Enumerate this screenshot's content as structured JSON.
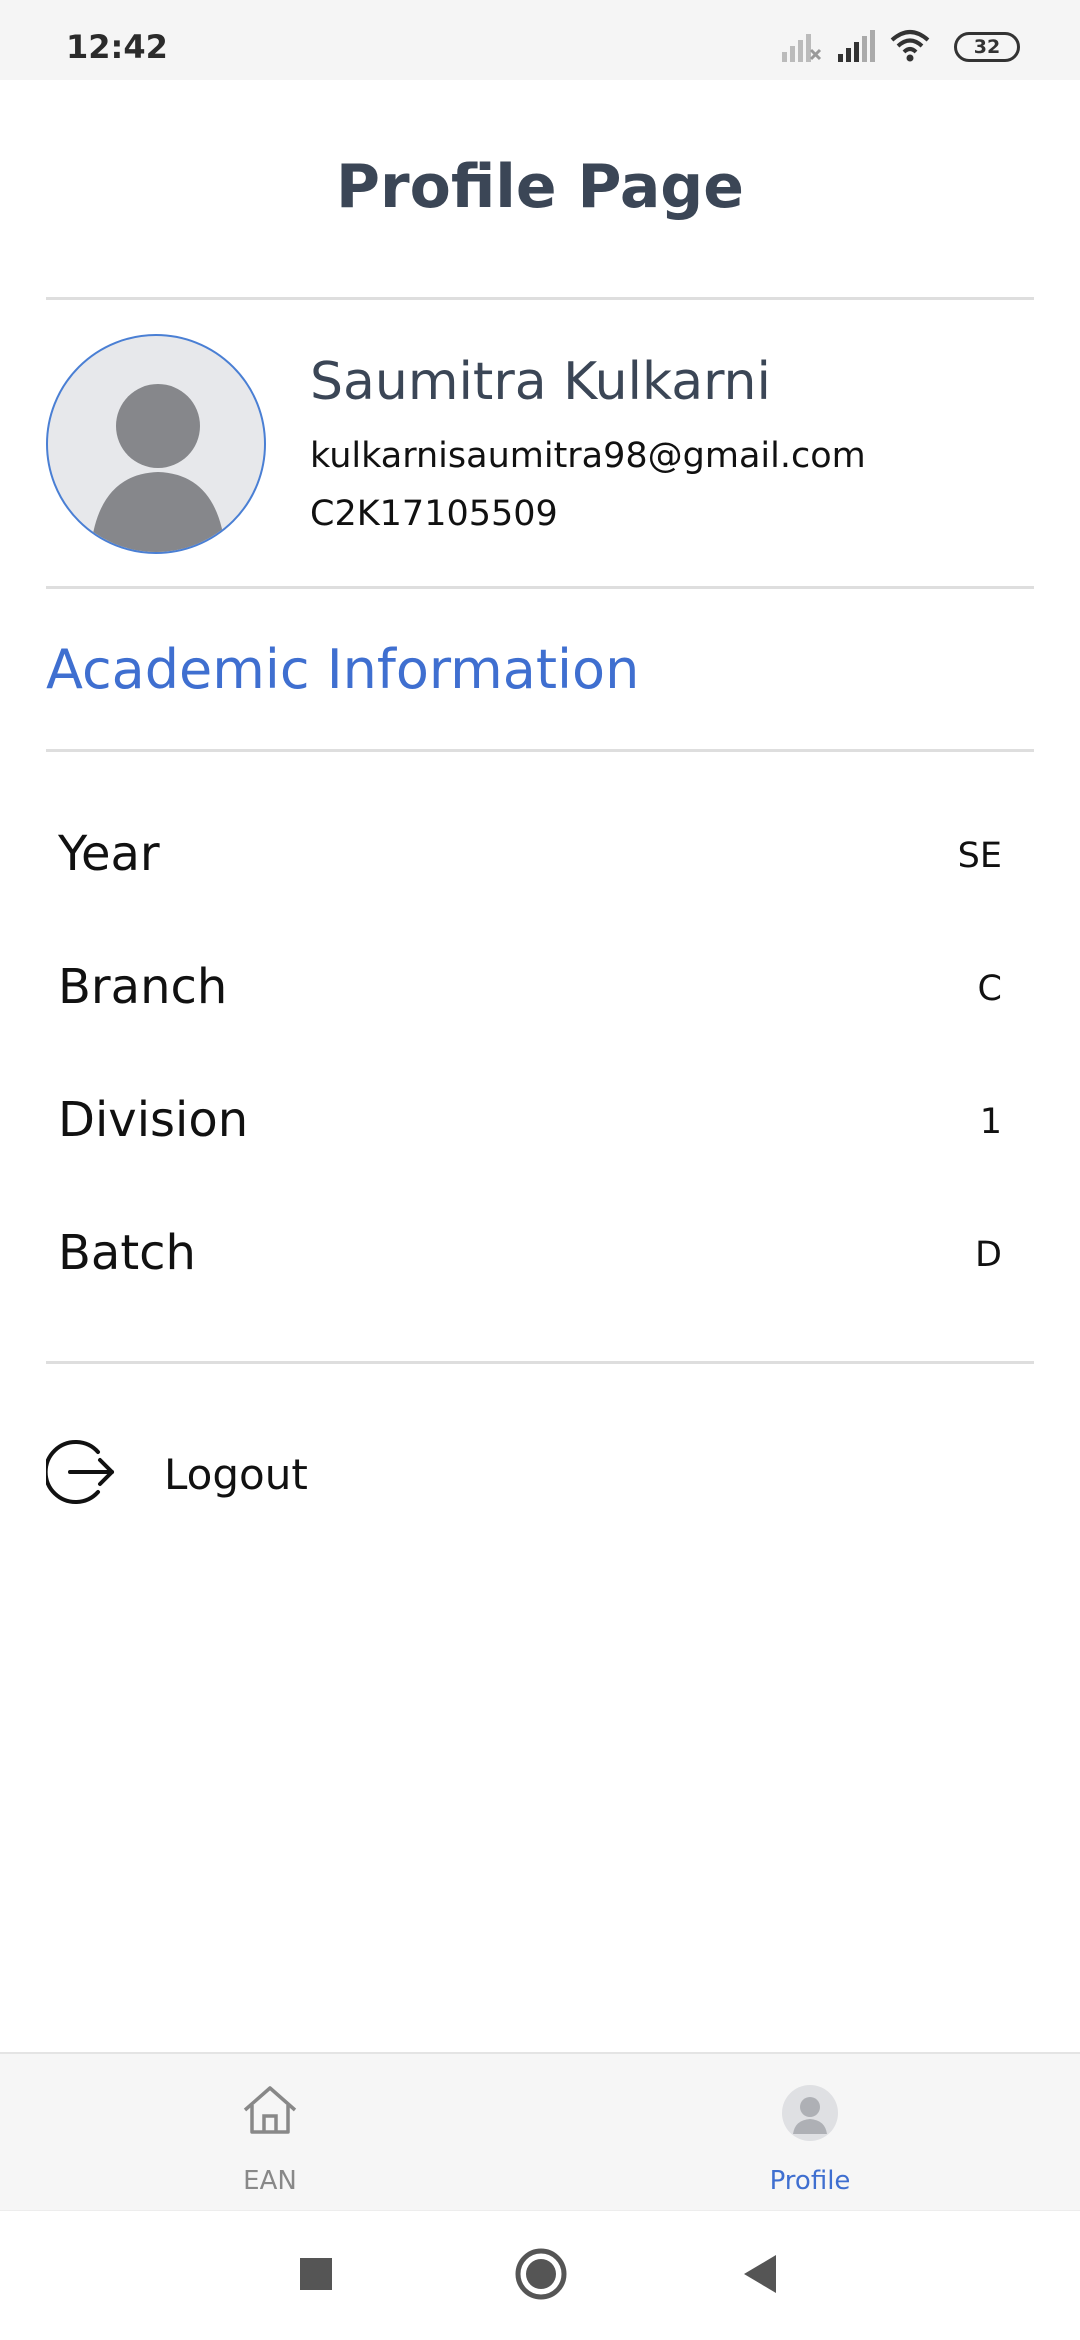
{
  "status_bar": {
    "time": "12:42",
    "battery": "32",
    "icons": [
      "signal-muted-icon",
      "signal-icon",
      "wifi-icon",
      "battery-icon"
    ]
  },
  "header": {
    "title": "Profile Page"
  },
  "profile": {
    "name": "Saumitra Kulkarni",
    "email": "kulkarnisaumitra98@gmail.com",
    "id": "C2K17105509",
    "avatar_icon": "avatar-placeholder-icon"
  },
  "academic": {
    "title": "Academic Information",
    "rows": [
      {
        "label": "Year",
        "value": "SE"
      },
      {
        "label": "Branch",
        "value": "C"
      },
      {
        "label": "Division",
        "value": "1"
      },
      {
        "label": "Batch",
        "value": "D"
      }
    ]
  },
  "logout": {
    "label": "Logout",
    "icon": "logout-icon"
  },
  "bottom_nav": {
    "items": [
      {
        "label": "EAN",
        "icon": "home-icon",
        "active": false
      },
      {
        "label": "Profile",
        "icon": "profile-icon",
        "active": true
      }
    ]
  },
  "system_nav": {
    "icons": [
      "recents-icon",
      "home-circle-icon",
      "back-icon"
    ]
  },
  "colors": {
    "accent": "#3f6fd0",
    "title": "#3b4656",
    "divider": "#dedede",
    "nav_active": "#3f6fd0",
    "nav_inactive": "#888888"
  }
}
